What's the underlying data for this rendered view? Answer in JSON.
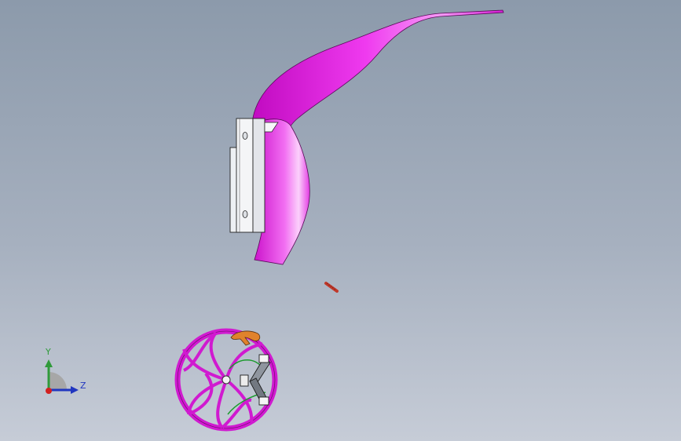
{
  "viewport": {
    "background_top": "#8c9aab",
    "background_bottom": "#c6ccd7"
  },
  "model": {
    "part_color": "#e61ee6",
    "mount_color": "#f2f3f6",
    "detail_color": "#d8691e",
    "pin_color": "#c0392b"
  },
  "triad": {
    "y_label": "Y",
    "z_label": "Z",
    "y_color": "#2f9a3a",
    "z_color": "#2036c0",
    "origin_color": "#d22020"
  }
}
